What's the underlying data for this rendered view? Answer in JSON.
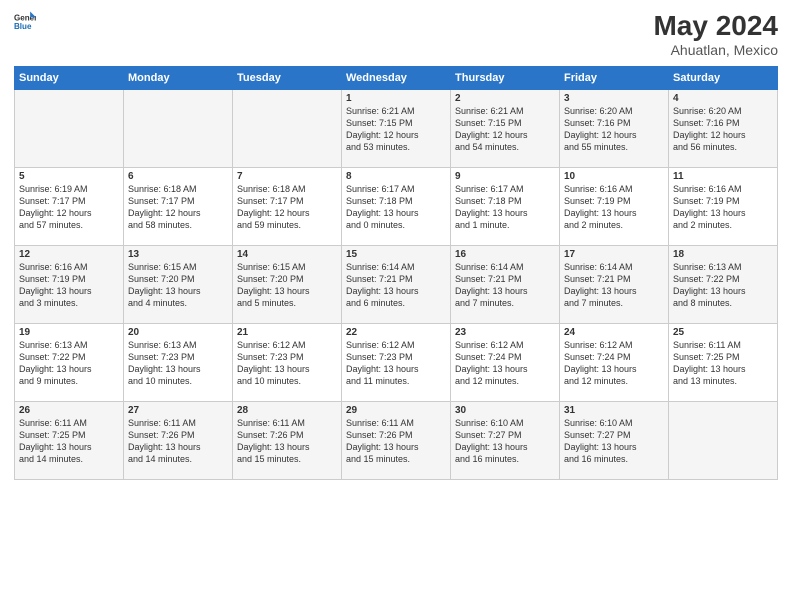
{
  "header": {
    "logo_general": "General",
    "logo_blue": "Blue",
    "title": "May 2024",
    "subtitle": "Ahuatlan, Mexico"
  },
  "days_of_week": [
    "Sunday",
    "Monday",
    "Tuesday",
    "Wednesday",
    "Thursday",
    "Friday",
    "Saturday"
  ],
  "weeks": [
    [
      {
        "day": "",
        "info": ""
      },
      {
        "day": "",
        "info": ""
      },
      {
        "day": "",
        "info": ""
      },
      {
        "day": "1",
        "info": "Sunrise: 6:21 AM\nSunset: 7:15 PM\nDaylight: 12 hours\nand 53 minutes."
      },
      {
        "day": "2",
        "info": "Sunrise: 6:21 AM\nSunset: 7:15 PM\nDaylight: 12 hours\nand 54 minutes."
      },
      {
        "day": "3",
        "info": "Sunrise: 6:20 AM\nSunset: 7:16 PM\nDaylight: 12 hours\nand 55 minutes."
      },
      {
        "day": "4",
        "info": "Sunrise: 6:20 AM\nSunset: 7:16 PM\nDaylight: 12 hours\nand 56 minutes."
      }
    ],
    [
      {
        "day": "5",
        "info": "Sunrise: 6:19 AM\nSunset: 7:17 PM\nDaylight: 12 hours\nand 57 minutes."
      },
      {
        "day": "6",
        "info": "Sunrise: 6:18 AM\nSunset: 7:17 PM\nDaylight: 12 hours\nand 58 minutes."
      },
      {
        "day": "7",
        "info": "Sunrise: 6:18 AM\nSunset: 7:17 PM\nDaylight: 12 hours\nand 59 minutes."
      },
      {
        "day": "8",
        "info": "Sunrise: 6:17 AM\nSunset: 7:18 PM\nDaylight: 13 hours\nand 0 minutes."
      },
      {
        "day": "9",
        "info": "Sunrise: 6:17 AM\nSunset: 7:18 PM\nDaylight: 13 hours\nand 1 minute."
      },
      {
        "day": "10",
        "info": "Sunrise: 6:16 AM\nSunset: 7:19 PM\nDaylight: 13 hours\nand 2 minutes."
      },
      {
        "day": "11",
        "info": "Sunrise: 6:16 AM\nSunset: 7:19 PM\nDaylight: 13 hours\nand 2 minutes."
      }
    ],
    [
      {
        "day": "12",
        "info": "Sunrise: 6:16 AM\nSunset: 7:19 PM\nDaylight: 13 hours\nand 3 minutes."
      },
      {
        "day": "13",
        "info": "Sunrise: 6:15 AM\nSunset: 7:20 PM\nDaylight: 13 hours\nand 4 minutes."
      },
      {
        "day": "14",
        "info": "Sunrise: 6:15 AM\nSunset: 7:20 PM\nDaylight: 13 hours\nand 5 minutes."
      },
      {
        "day": "15",
        "info": "Sunrise: 6:14 AM\nSunset: 7:21 PM\nDaylight: 13 hours\nand 6 minutes."
      },
      {
        "day": "16",
        "info": "Sunrise: 6:14 AM\nSunset: 7:21 PM\nDaylight: 13 hours\nand 7 minutes."
      },
      {
        "day": "17",
        "info": "Sunrise: 6:14 AM\nSunset: 7:21 PM\nDaylight: 13 hours\nand 7 minutes."
      },
      {
        "day": "18",
        "info": "Sunrise: 6:13 AM\nSunset: 7:22 PM\nDaylight: 13 hours\nand 8 minutes."
      }
    ],
    [
      {
        "day": "19",
        "info": "Sunrise: 6:13 AM\nSunset: 7:22 PM\nDaylight: 13 hours\nand 9 minutes."
      },
      {
        "day": "20",
        "info": "Sunrise: 6:13 AM\nSunset: 7:23 PM\nDaylight: 13 hours\nand 10 minutes."
      },
      {
        "day": "21",
        "info": "Sunrise: 6:12 AM\nSunset: 7:23 PM\nDaylight: 13 hours\nand 10 minutes."
      },
      {
        "day": "22",
        "info": "Sunrise: 6:12 AM\nSunset: 7:23 PM\nDaylight: 13 hours\nand 11 minutes."
      },
      {
        "day": "23",
        "info": "Sunrise: 6:12 AM\nSunset: 7:24 PM\nDaylight: 13 hours\nand 12 minutes."
      },
      {
        "day": "24",
        "info": "Sunrise: 6:12 AM\nSunset: 7:24 PM\nDaylight: 13 hours\nand 12 minutes."
      },
      {
        "day": "25",
        "info": "Sunrise: 6:11 AM\nSunset: 7:25 PM\nDaylight: 13 hours\nand 13 minutes."
      }
    ],
    [
      {
        "day": "26",
        "info": "Sunrise: 6:11 AM\nSunset: 7:25 PM\nDaylight: 13 hours\nand 14 minutes."
      },
      {
        "day": "27",
        "info": "Sunrise: 6:11 AM\nSunset: 7:26 PM\nDaylight: 13 hours\nand 14 minutes."
      },
      {
        "day": "28",
        "info": "Sunrise: 6:11 AM\nSunset: 7:26 PM\nDaylight: 13 hours\nand 15 minutes."
      },
      {
        "day": "29",
        "info": "Sunrise: 6:11 AM\nSunset: 7:26 PM\nDaylight: 13 hours\nand 15 minutes."
      },
      {
        "day": "30",
        "info": "Sunrise: 6:10 AM\nSunset: 7:27 PM\nDaylight: 13 hours\nand 16 minutes."
      },
      {
        "day": "31",
        "info": "Sunrise: 6:10 AM\nSunset: 7:27 PM\nDaylight: 13 hours\nand 16 minutes."
      },
      {
        "day": "",
        "info": ""
      }
    ]
  ]
}
